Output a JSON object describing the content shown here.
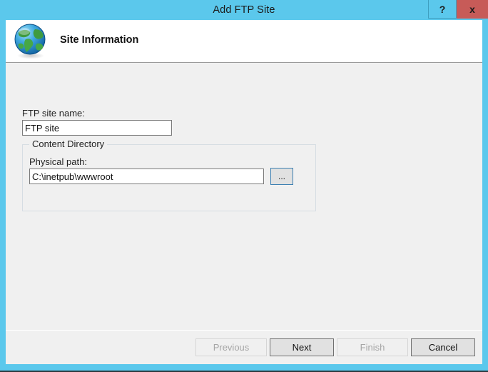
{
  "window": {
    "title": "Add FTP Site",
    "titlebar_color": "#5bc8ec",
    "close_button_color": "#c75b58",
    "help_button_label": "?",
    "close_button_label": "x"
  },
  "header": {
    "heading": "Site Information",
    "icon": "globe-icon"
  },
  "form": {
    "site_name": {
      "label": "FTP site name:",
      "value": "FTP site"
    },
    "content_directory": {
      "group_label": "Content Directory",
      "physical_path": {
        "label": "Physical path:",
        "value": "C:\\inetpub\\wwwroot"
      },
      "browse_button_label": "..."
    }
  },
  "footer": {
    "buttons": [
      {
        "label": "Previous",
        "enabled": false
      },
      {
        "label": "Next",
        "enabled": true
      },
      {
        "label": "Finish",
        "enabled": false
      },
      {
        "label": "Cancel",
        "enabled": true
      }
    ]
  }
}
